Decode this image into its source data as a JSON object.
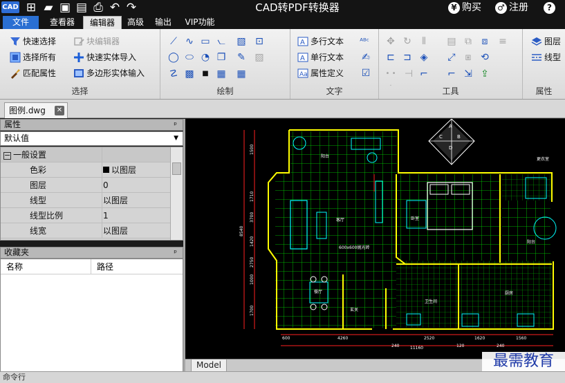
{
  "titlebar": {
    "logo": "CAD",
    "title": "CAD转PDF转换器",
    "buy": "购买",
    "register": "注册",
    "help_glyph": "?"
  },
  "menu": {
    "file": "文件",
    "tabs": [
      "查看器",
      "编辑器",
      "高级",
      "输出",
      "VIP功能"
    ],
    "active_index": 1
  },
  "ribbon": {
    "select_group": {
      "label": "选择",
      "items": [
        "快速选择",
        "块编辑器",
        "选择所有",
        "快速实体导入",
        "匹配属性",
        "多边形实体输入"
      ]
    },
    "draw_group": {
      "label": "绘制"
    },
    "text_group": {
      "label": "文字",
      "items": [
        "多行文本",
        "单行文本",
        "属性定义"
      ]
    },
    "tools_group": {
      "label": "工具"
    },
    "props_group": {
      "label": "属性",
      "items": [
        "图层",
        "线型"
      ]
    }
  },
  "document": {
    "tab_label": "图例.dwg",
    "close_glyph": "✕"
  },
  "properties_panel": {
    "title": "属性",
    "pin_glyph": "ᵖ",
    "selected": "默认值",
    "category": "一般设置",
    "rows": [
      {
        "key": "色彩",
        "value": "以图层"
      },
      {
        "key": "图层",
        "value": "0"
      },
      {
        "key": "线型",
        "value": "以图层"
      },
      {
        "key": "线型比例",
        "value": "1"
      },
      {
        "key": "线宽",
        "value": "以图层"
      }
    ]
  },
  "favorites_panel": {
    "title": "收藏夹",
    "pin_glyph": "ᵖ",
    "columns": [
      "名称",
      "路径"
    ]
  },
  "drawing": {
    "rooms": [
      "阳台",
      "客厅",
      "600x600抛光砖",
      "卧室",
      "餐厅",
      "卫生间",
      "厨房",
      "玄关",
      "阳台",
      "更衣室"
    ],
    "dims_bottom": [
      "600",
      "4260",
      "2520",
      "1620",
      "1560",
      "240",
      "11160",
      "120",
      "240"
    ],
    "dims_left": [
      "1500",
      "1710",
      "3700",
      "1420",
      "2750",
      "1000",
      "1700"
    ],
    "dim_total_left": "8540",
    "compass": [
      "A",
      "B",
      "C",
      "D"
    ]
  },
  "model_tab": "Model",
  "command_label": "命令行",
  "watermark": "最需教育",
  "colors": {
    "accent_blue": "#2a6fd2",
    "wall_yellow": "#ffff00",
    "floor_green": "#00ff00",
    "dim_red": "#ff2020",
    "furniture_cyan": "#00ffff"
  }
}
